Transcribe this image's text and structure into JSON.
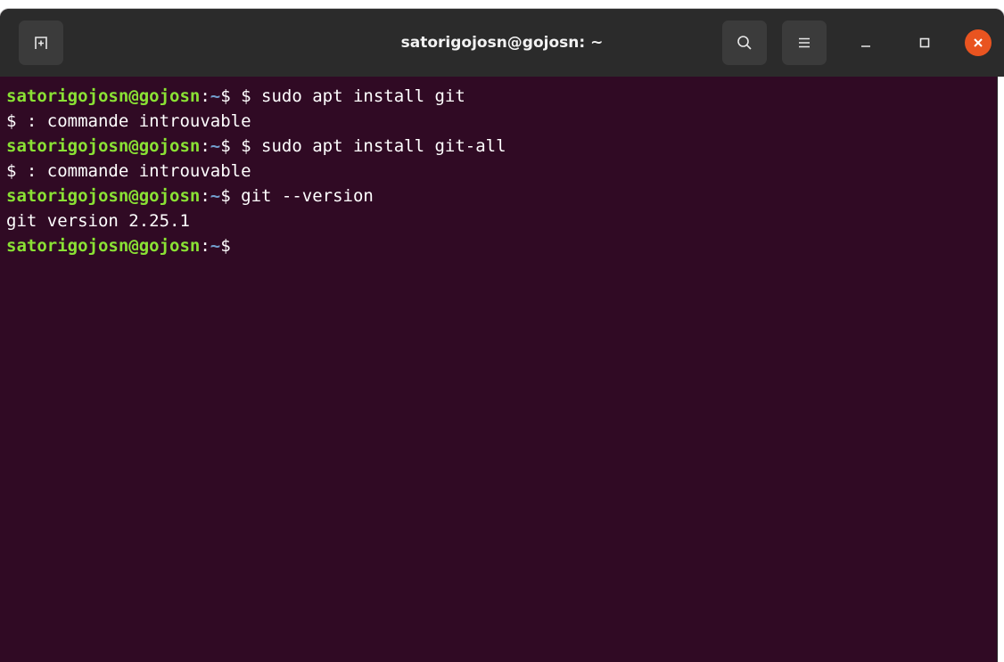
{
  "window": {
    "title": "satorigojosn@gojosn: ~"
  },
  "titlebar": {
    "new_tab_icon": "new-tab-icon",
    "search_icon": "search-icon",
    "menu_icon": "hamburger-menu-icon",
    "minimize_icon": "minimize-icon",
    "maximize_icon": "maximize-icon",
    "close_icon": "close-icon"
  },
  "colors": {
    "terminal_bg": "#300a24",
    "prompt_user": "#8ae234",
    "prompt_path": "#729fcf",
    "close_button": "#e95420",
    "titlebar_bg": "#2b2b2b"
  },
  "terminal": {
    "lines": [
      {
        "type": "prompt",
        "user": "satorigojosn@gojosn",
        "sep": ":",
        "path": "~",
        "symbol": "$",
        "command": " $ sudo apt install git"
      },
      {
        "type": "output",
        "text": "$ : commande introuvable"
      },
      {
        "type": "prompt",
        "user": "satorigojosn@gojosn",
        "sep": ":",
        "path": "~",
        "symbol": "$",
        "command": " $ sudo apt install git-all"
      },
      {
        "type": "output",
        "text": "$ : commande introuvable"
      },
      {
        "type": "prompt",
        "user": "satorigojosn@gojosn",
        "sep": ":",
        "path": "~",
        "symbol": "$",
        "command": " git --version"
      },
      {
        "type": "output",
        "text": "git version 2.25.1"
      },
      {
        "type": "prompt",
        "user": "satorigojosn@gojosn",
        "sep": ":",
        "path": "~",
        "symbol": "$",
        "command": ""
      }
    ]
  }
}
